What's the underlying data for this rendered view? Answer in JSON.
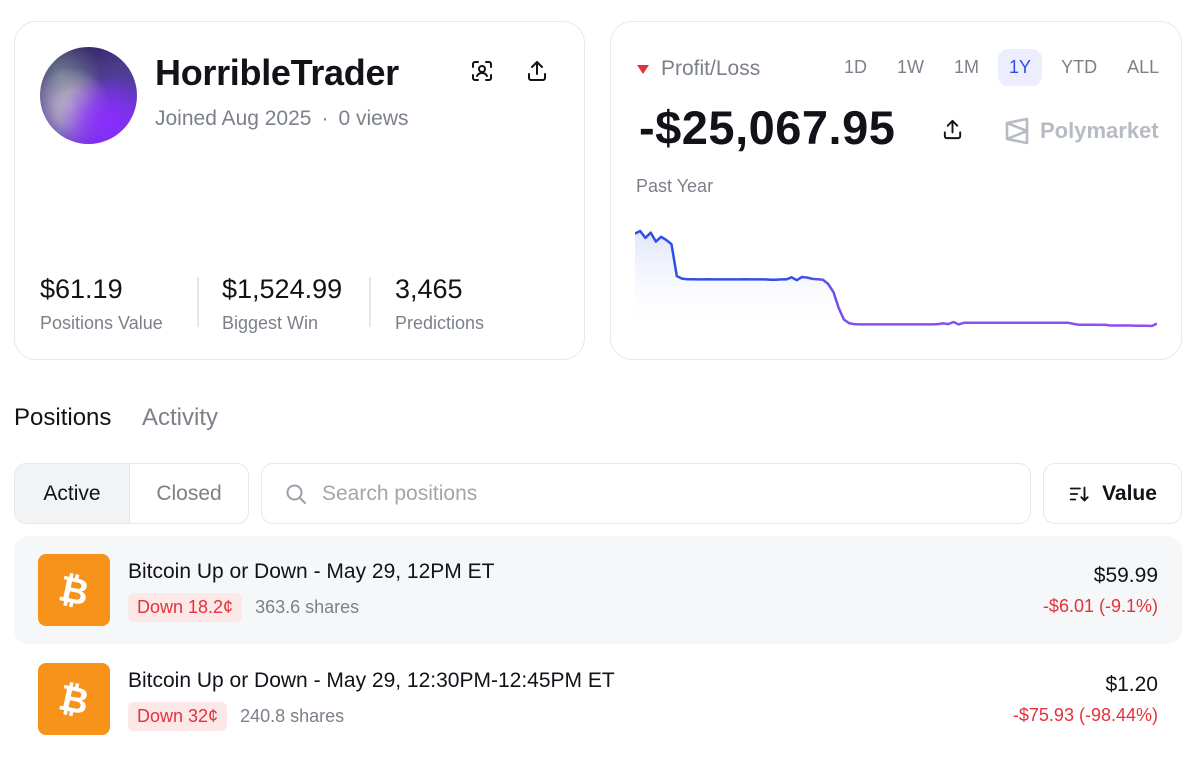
{
  "profile": {
    "username": "HorribleTrader",
    "joined": "Joined Aug 2025",
    "separator": "·",
    "views": "0 views",
    "stats": [
      {
        "value": "$61.19",
        "label": "Positions Value"
      },
      {
        "value": "$1,524.99",
        "label": "Biggest Win"
      },
      {
        "value": "3,465",
        "label": "Predictions"
      }
    ]
  },
  "pnl": {
    "label": "Profit/Loss",
    "direction": "down",
    "value": "-$25,067.95",
    "brand": "Polymarket",
    "period_label": "Past Year",
    "ranges": [
      "1D",
      "1W",
      "1M",
      "1Y",
      "YTD",
      "ALL"
    ],
    "active_range": "1Y",
    "colors": {
      "negative": "#e5313b",
      "accent": "#2e4ee8",
      "line_start": "#2f4fe6",
      "line_end": "#8a4ff0"
    }
  },
  "chart_data": {
    "type": "line",
    "title": "",
    "xlabel": "",
    "ylabel": "",
    "grid": false,
    "x": [
      0,
      1,
      2,
      3,
      4,
      5,
      6,
      7,
      8,
      9,
      10,
      11,
      12,
      13,
      14,
      15,
      16,
      17,
      18,
      19,
      20,
      21,
      22,
      23,
      24,
      25,
      26,
      27,
      28,
      29,
      30,
      31,
      32,
      33,
      34,
      35,
      36,
      37,
      38,
      39,
      40,
      41,
      42,
      43,
      44,
      45,
      46,
      47,
      48,
      49,
      50,
      51,
      52,
      53,
      54,
      55,
      56,
      57,
      58,
      59,
      60,
      61,
      62,
      63,
      64,
      65,
      66,
      67,
      68,
      69,
      70,
      71,
      72,
      73,
      74,
      75,
      76,
      77,
      78,
      79,
      80,
      81,
      82,
      83,
      84,
      85,
      86,
      87,
      88,
      89,
      90,
      91,
      92,
      93,
      94,
      95,
      96,
      97,
      98,
      99,
      100
    ],
    "series": [
      {
        "values": [
          -2000,
          -1500,
          -2800,
          -1800,
          -3500,
          -2600,
          -3200,
          -4000,
          -10000,
          -10500,
          -10600,
          -10600,
          -10650,
          -10650,
          -10600,
          -10650,
          -10650,
          -10650,
          -10650,
          -10650,
          -10650,
          -10600,
          -10650,
          -10650,
          -10650,
          -10650,
          -10700,
          -10700,
          -10650,
          -10650,
          -10250,
          -10800,
          -10200,
          -10300,
          -10550,
          -10600,
          -10700,
          -11500,
          -13000,
          -16000,
          -18200,
          -18900,
          -19100,
          -19150,
          -19150,
          -19150,
          -19150,
          -19150,
          -19150,
          -19150,
          -19150,
          -19150,
          -19150,
          -19150,
          -19150,
          -19150,
          -19150,
          -19150,
          -19100,
          -18950,
          -19100,
          -18700,
          -19150,
          -18850,
          -18850,
          -18850,
          -18850,
          -18850,
          -18850,
          -18850,
          -18850,
          -18850,
          -18850,
          -18850,
          -18850,
          -18850,
          -18850,
          -18850,
          -18850,
          -18850,
          -18850,
          -18850,
          -18850,
          -18850,
          -19050,
          -19200,
          -19200,
          -19200,
          -19200,
          -19250,
          -19200,
          -19350,
          -19350,
          -19350,
          -19350,
          -19350,
          -19400,
          -19400,
          -19400,
          -19450,
          -19000
        ]
      }
    ]
  },
  "tabs": {
    "positions": "Positions",
    "activity": "Activity",
    "active": "Positions"
  },
  "filter": {
    "active": "Active",
    "closed": "Closed",
    "selected": "Active"
  },
  "search": {
    "placeholder": "Search positions"
  },
  "sort": {
    "label": "Value"
  },
  "positions": [
    {
      "title": "Bitcoin Up or Down - May 29, 12PM ET",
      "outcome": "Down 18.2¢",
      "shares": "363.6 shares",
      "value": "$59.99",
      "change": "-$6.01 (-9.1%)",
      "icon": "bitcoin-icon",
      "icon_color": "#f7931a"
    },
    {
      "title": "Bitcoin Up or Down - May 29, 12:30PM-12:45PM ET",
      "outcome": "Down 32¢",
      "shares": "240.8 shares",
      "value": "$1.20",
      "change": "-$75.93 (-98.44%)",
      "icon": "bitcoin-icon",
      "icon_color": "#f7931a"
    }
  ]
}
